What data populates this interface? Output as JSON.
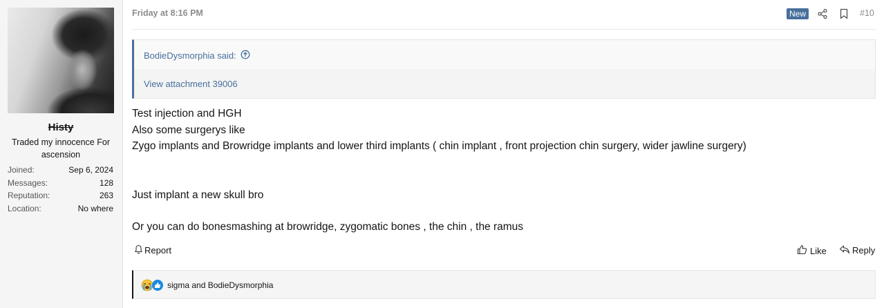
{
  "user": {
    "name": "Histy",
    "title": "Traded my innocence For ascension",
    "stats": [
      {
        "label": "Joined:",
        "value": "Sep 6, 2024"
      },
      {
        "label": "Messages:",
        "value": "128"
      },
      {
        "label": "Reputation:",
        "value": "263"
      },
      {
        "label": "Location:",
        "value": "No where"
      }
    ]
  },
  "post": {
    "date": "Friday at 8:16 PM",
    "badge": "New",
    "number": "#10",
    "quote": {
      "author": "BodieDysmorphia said:",
      "attachment": "View attachment 39006"
    },
    "body": {
      "line1": "Test injection and HGH",
      "line2": "Also some surgerys like",
      "line3": "Zygo implants and Browridge implants and lower third implants ( chin implant , front projection chin surgery, wider jawline surgery)",
      "line4": "Just implant a new skull bro",
      "line5": "Or you can do bonesmashing at browridge, zygomatic bones , the chin , the ramus"
    },
    "actions": {
      "report": "Report",
      "like": "Like",
      "reply": "Reply"
    },
    "reactions": {
      "icons": [
        "crying-face-icon",
        "thumbs-up-blue-icon"
      ],
      "text": "sigma and BodieDysmorphia"
    }
  },
  "colors": {
    "accent": "#47709c",
    "panel_bg": "#f5f5f5",
    "muted": "#8c8c8c"
  }
}
